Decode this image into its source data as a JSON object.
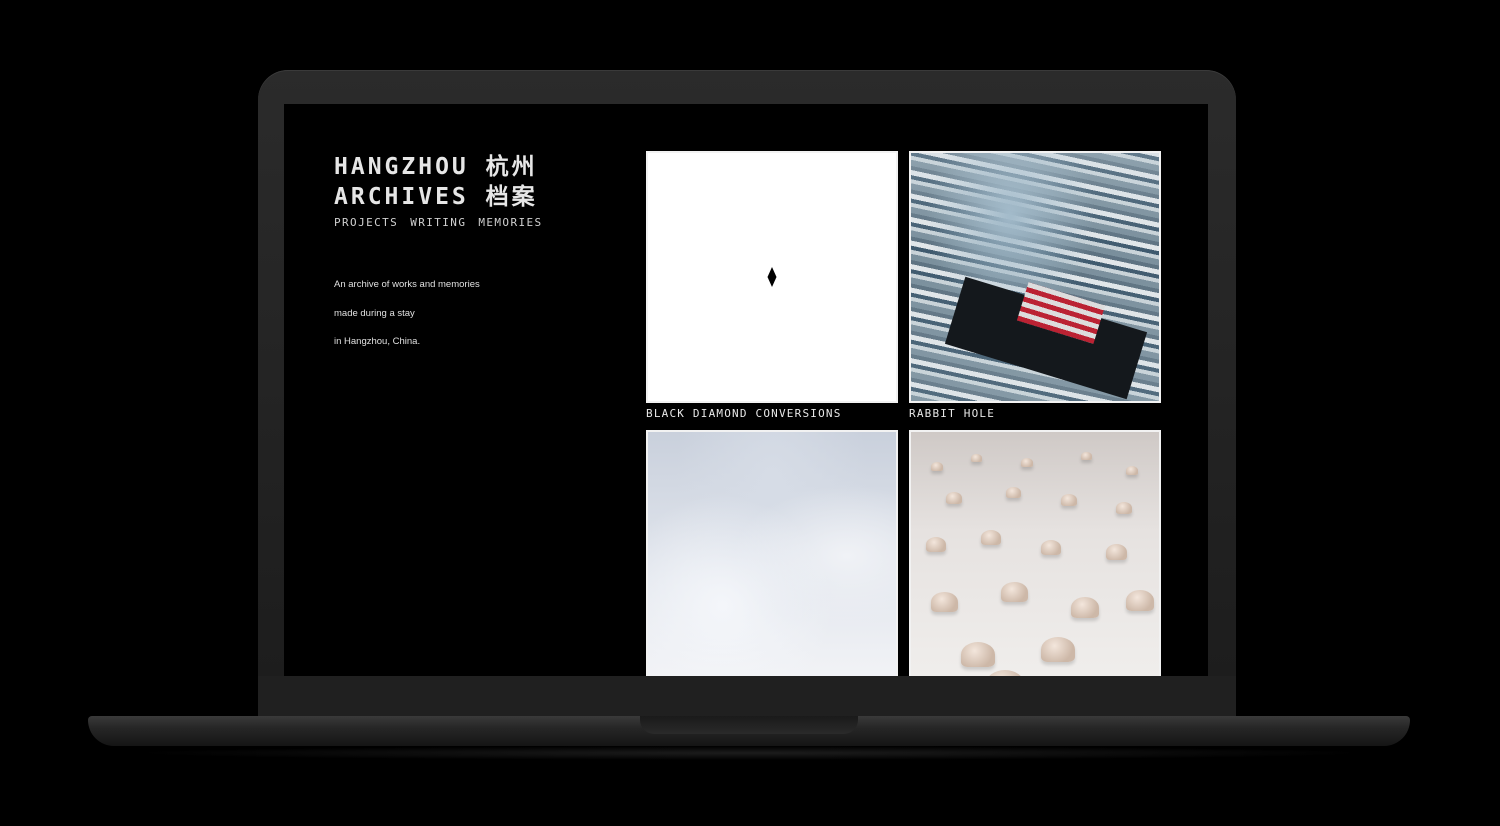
{
  "site": {
    "title_line1": "HANGZHOU 杭州",
    "title_line2": "ARCHIVES 档案"
  },
  "nav": {
    "items": [
      "PROJECTS",
      "WRITING",
      "MEMORIES"
    ]
  },
  "intro": {
    "lines": [
      "An archive of works and memories",
      "made during a stay",
      "in Hangzhou, China."
    ]
  },
  "projects": [
    {
      "title": "BLACK DIAMOND CONVERSIONS",
      "thumbnail": "black-diamond"
    },
    {
      "title": "RABBIT HOLE",
      "thumbnail": "collage-of-photos"
    },
    {
      "title": "",
      "thumbnail": "clouds-sky"
    },
    {
      "title": "",
      "thumbnail": "field-of-helmets"
    }
  ],
  "colors": {
    "background": "#000000",
    "text": "#e6e6e6",
    "laptop_body": "#242424"
  }
}
